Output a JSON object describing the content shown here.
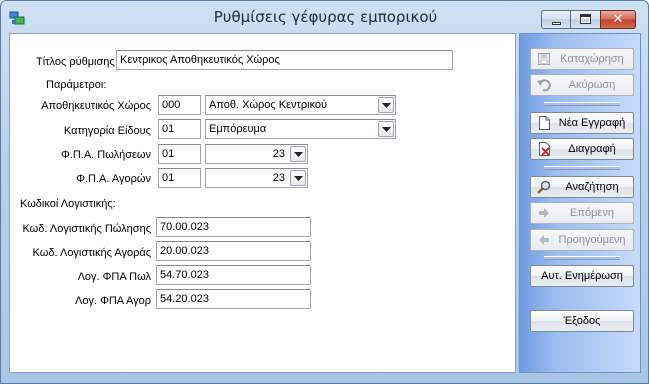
{
  "window": {
    "title": "Ρυθμίσεις γέφυρας εμπορικού"
  },
  "form": {
    "title_label": "Τίτλος ρύθμισης",
    "title_value": "Κεντρικος Αποθηκευτικός Χώρος",
    "params_header": "Παράμετροι:",
    "warehouse": {
      "label": "Αποθηκευτικός Χώρος",
      "code": "000",
      "name": "Αποθ. Χώρος Κεντρικού"
    },
    "category": {
      "label": "Κατηγορία Είδους",
      "code": "01",
      "name": "Εμπόρευμα"
    },
    "vat_sales": {
      "label": "Φ.Π.Α. Πωλήσεων",
      "code": "01",
      "rate": "23"
    },
    "vat_purch": {
      "label": "Φ.Π.Α. Αγορών",
      "code": "01",
      "rate": "23"
    },
    "accounts_header": "Κωδικοί Λογιστικής:",
    "acc_sales": {
      "label": "Κωδ. Λογιστικής Πώλησης",
      "value": "70.00.023"
    },
    "acc_purch": {
      "label": "Κωδ. Λογιστικής Αγοράς",
      "value": "20.00.023"
    },
    "vat_acc_sales": {
      "label": "Λογ. ΦΠΑ Πωλ",
      "value": "54.70.023"
    },
    "vat_acc_purch": {
      "label": "Λογ. ΦΠΑ Αγορ",
      "value": "54.20.023"
    }
  },
  "sidebar": {
    "save": "Καταχώρηση",
    "cancel": "Ακύρωση",
    "new": "Νέα Εγγραφή",
    "delete": "Διαγραφή",
    "search": "Αναζήτηση",
    "next": "Επόμενη",
    "prev": "Προηγούμενη",
    "auto_update": "Αυτ. Ενημέρωση",
    "exit": "Έξοδος"
  }
}
